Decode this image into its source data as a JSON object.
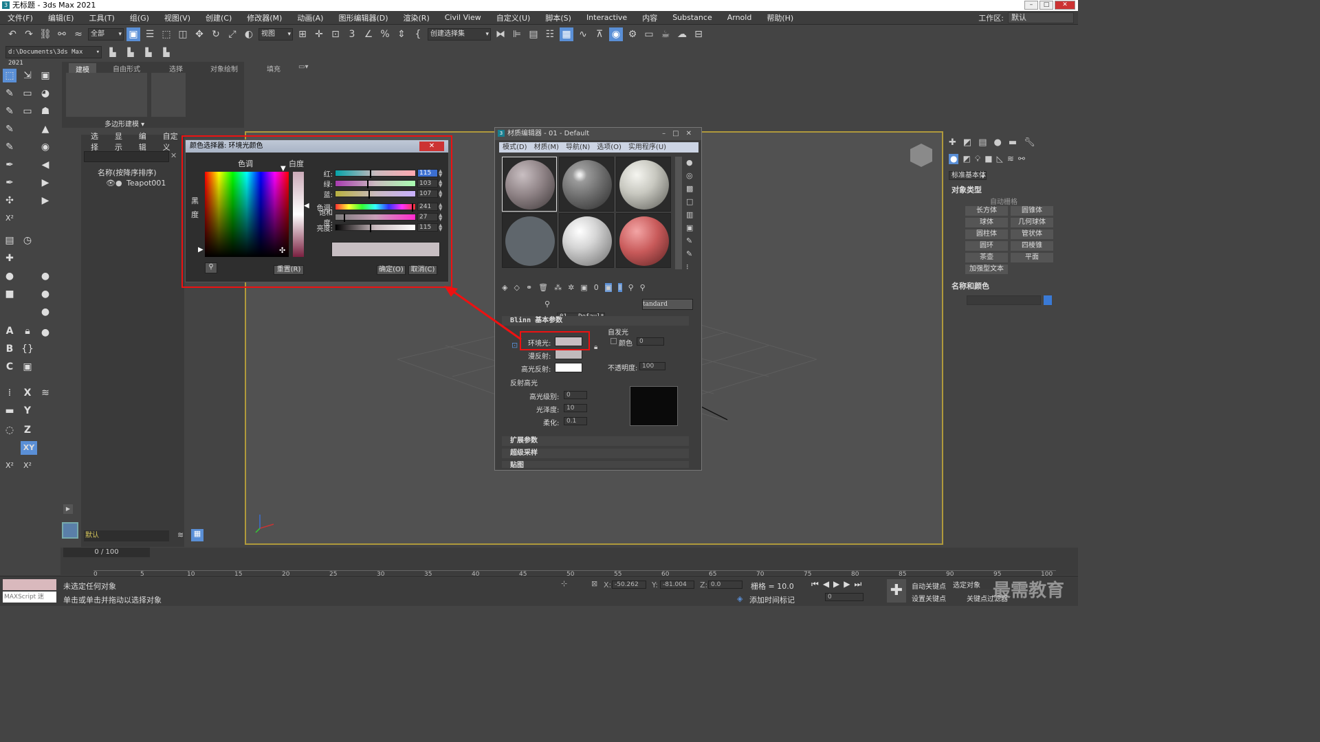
{
  "title": "无标题 - 3ds Max 2021",
  "menu": [
    "文件(F)",
    "编辑(E)",
    "工具(T)",
    "组(G)",
    "视图(V)",
    "创建(C)",
    "修改器(M)",
    "动画(A)",
    "图形编辑器(D)",
    "渲染(R)",
    "Civil View",
    "自定义(U)",
    "脚本(S)",
    "Interactive",
    "内容",
    "Substance",
    "Arnold",
    "帮助(H)"
  ],
  "workspace": {
    "label": "工作区:",
    "value": "默认"
  },
  "toolbar": {
    "filter": "全部",
    "view": "视图",
    "selset": "创建选择集"
  },
  "path": "d:\\Documents\\3ds Max 2021",
  "ribbon": {
    "tabs": [
      "建模",
      "自由形式",
      "选择",
      "对象绘制",
      "填充"
    ],
    "group": "多边形建模 ▾"
  },
  "scene": {
    "tabs": [
      "选择",
      "显示",
      "编辑",
      "自定义"
    ],
    "col_header": "名称(按降序排序)",
    "item": "Teapot001",
    "layer": "默认"
  },
  "color_selector": {
    "title": "颜色选择器: 环境光颜色",
    "hue_label": "色调",
    "white_label": "白度",
    "black_label": "黑",
    "degree_label": "度",
    "rows": [
      {
        "label": "红:",
        "value": "115"
      },
      {
        "label": "绿:",
        "value": "103"
      },
      {
        "label": "蓝:",
        "value": "107"
      },
      {
        "label": "色调:",
        "value": "241"
      },
      {
        "label": "饱和度:",
        "value": "27"
      },
      {
        "label": "亮度:",
        "value": "115"
      }
    ],
    "reset": "重置(R)",
    "ok": "确定(O)",
    "cancel": "取消(C)",
    "preview_color": "#c7bec2"
  },
  "material_editor": {
    "title": "材质编辑器 - 01 - Default",
    "menus": [
      "模式(D)",
      "材质(M)",
      "导航(N)",
      "选项(O)",
      "实用程序(U)"
    ],
    "mat_name": "01 - Default",
    "mat_type": "tandard (Legacy",
    "rollout": "Blinn 基本参数",
    "ambient": "环境光:",
    "diffuse": "漫反射:",
    "specular": "高光反射:",
    "self_illum": "自发光",
    "color": "颜色",
    "color_val": "0",
    "opacity": "不透明度:",
    "opacity_val": "100",
    "spec_highlights": "反射高光",
    "spec_level": "高光级别:",
    "spec_level_val": "0",
    "gloss": "光泽度:",
    "gloss_val": "10",
    "soften": "柔化:",
    "soften_val": "0.1",
    "rollouts": [
      "扩展参数",
      "超级采样",
      "贴图"
    ]
  },
  "right_panel": {
    "dropdown": "标准基本体",
    "section1": "对象类型",
    "autogrid": "自动栅格",
    "buttons": [
      "长方体",
      "圆锥体",
      "球体",
      "几何球体",
      "圆柱体",
      "管状体",
      "圆环",
      "四棱锥",
      "茶壶",
      "平面",
      "加强型文本"
    ],
    "section2": "名称和颜色"
  },
  "timeline": {
    "frame": "0 / 100",
    "ticks": [
      "0",
      "5",
      "10",
      "15",
      "20",
      "25",
      "30",
      "35",
      "40",
      "45",
      "50",
      "55",
      "60",
      "65",
      "70",
      "75",
      "80",
      "85",
      "90",
      "95",
      "100"
    ]
  },
  "status": {
    "script": "MAXScript 迷",
    "line1": "未选定任何对象",
    "line2": "单击或单击并拖动以选择对象",
    "x": "-50.262",
    "y": "-81.004",
    "z": "0.0",
    "grid": "栅格 = 10.0",
    "add_tag": "添加时间标记",
    "autokey": "自动关键点",
    "setkey": "设置关键点",
    "selobj": "选定对象",
    "keyfilter": "关键点过滤器",
    "frame": "0"
  },
  "watermark": "最需教育"
}
